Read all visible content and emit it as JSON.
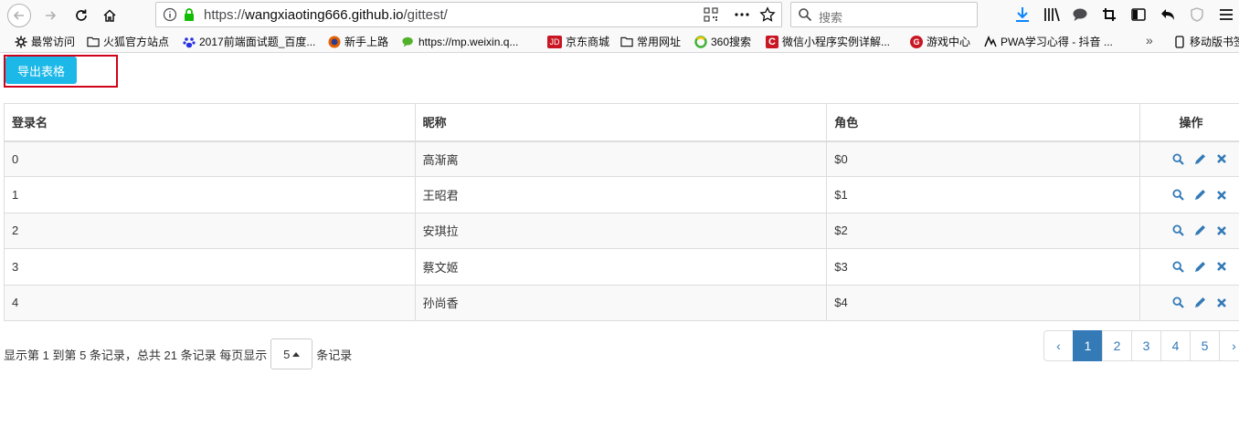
{
  "browser": {
    "url_prefix": "https://",
    "url_host": "wangxiaoting666.github.io",
    "url_path": "/gittest/",
    "search_placeholder": "搜索"
  },
  "bookmarks": [
    {
      "label": "最常访问",
      "icon": "gear-icon"
    },
    {
      "label": "火狐官方站点",
      "icon": "folder-icon"
    },
    {
      "label": "2017前端面试题_百度...",
      "icon": "baidu-paw-icon"
    },
    {
      "label": "新手上路",
      "icon": "firefox-icon"
    },
    {
      "label": "https://mp.weixin.q...",
      "icon": "wechat-icon"
    },
    {
      "label": "京东商城",
      "icon": "jd-icon"
    },
    {
      "label": "常用网址",
      "icon": "folder-icon"
    },
    {
      "label": "360搜索",
      "icon": "360-icon"
    },
    {
      "label": "微信小程序实例详解...",
      "icon": "csdn-icon"
    },
    {
      "label": "游戏中心",
      "icon": "game-icon"
    },
    {
      "label": "PWA学习心得 - 抖音 ...",
      "icon": "pwa-icon"
    },
    {
      "label": "移动版书签",
      "icon": "mobile-icon"
    }
  ],
  "export_button": "导出表格",
  "table": {
    "headers": [
      "登录名",
      "昵称",
      "角色",
      "操作"
    ],
    "rows": [
      {
        "login": "0",
        "nickname": "高渐离",
        "role": "$0"
      },
      {
        "login": "1",
        "nickname": "王昭君",
        "role": "$1"
      },
      {
        "login": "2",
        "nickname": "安琪拉",
        "role": "$2"
      },
      {
        "login": "3",
        "nickname": "蔡文姬",
        "role": "$3"
      },
      {
        "login": "4",
        "nickname": "孙尚香",
        "role": "$4"
      }
    ]
  },
  "pager": {
    "info_before": "显示第 1 到第 5 条记录，总共 21 条记录 每页显示",
    "page_size": "5",
    "info_after": "条记录",
    "prev": "‹",
    "pages": [
      "1",
      "2",
      "3",
      "4",
      "5"
    ],
    "next": "›",
    "active_page": "1"
  },
  "colors": {
    "export_button": "#1cb8e8",
    "annotation": "#d0021b",
    "link": "#337ab7"
  }
}
